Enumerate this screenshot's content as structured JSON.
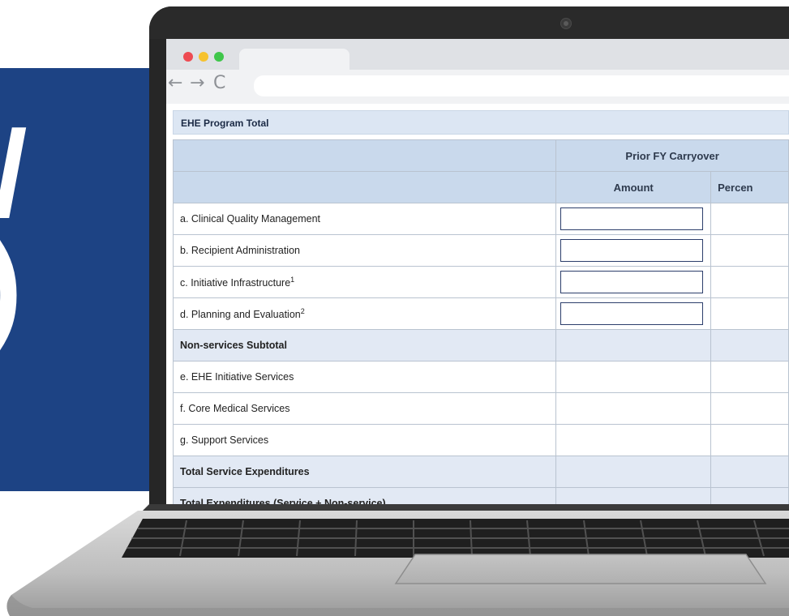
{
  "slide": {
    "glyph_1": "/",
    "glyph_2": ")"
  },
  "browser": {
    "back_icon": "←",
    "forward_icon": "→",
    "reload_icon": "C",
    "url_value": ""
  },
  "form": {
    "section_title": "EHE Program Total",
    "group_header": "Prior FY Carryover",
    "column_amount": "Amount",
    "column_percent": "Percen",
    "rows": [
      {
        "label": "a. Clinical Quality Management",
        "sup": ""
      },
      {
        "label": "b. Recipient Administration",
        "sup": ""
      },
      {
        "label": "c. Initiative Infrastructure",
        "sup": "1"
      },
      {
        "label": "d. Planning and Evaluation",
        "sup": "2"
      },
      {
        "label": "Non-services Subtotal",
        "sup": ""
      },
      {
        "label": "e. EHE Initiative Services",
        "sup": ""
      },
      {
        "label": "f. Core Medical Services",
        "sup": ""
      },
      {
        "label": "g. Support Services",
        "sup": ""
      },
      {
        "label": "Total Service Expenditures",
        "sup": ""
      },
      {
        "label": "Total Expenditures (Service + Non-service)",
        "sup": ""
      }
    ]
  },
  "colors": {
    "slide_blue": "#1d4384",
    "header_blue": "#c9d9ec",
    "subtotal_fill": "#e2e9f4"
  }
}
